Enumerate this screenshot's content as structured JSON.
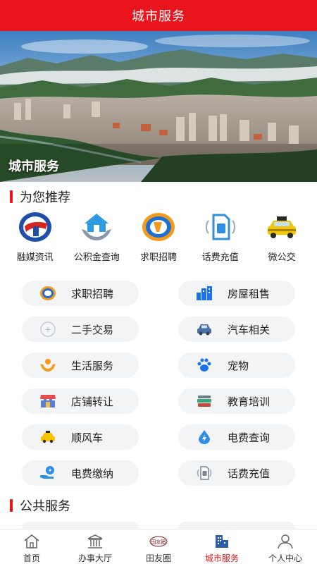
{
  "header": {
    "title": "城市服务"
  },
  "banner": {
    "caption": "城市服务"
  },
  "recommend": {
    "title": "为您推荐",
    "items": [
      {
        "label": "融媒资讯",
        "icon": "media-logo-icon"
      },
      {
        "label": "公积金查询",
        "icon": "house-hands-icon"
      },
      {
        "label": "求职招聘",
        "icon": "job-logo-icon"
      },
      {
        "label": "话费充值",
        "icon": "sim-card-icon"
      },
      {
        "label": "微公交",
        "icon": "taxi-icon"
      }
    ]
  },
  "services": [
    {
      "label": "求职招聘",
      "icon": "job-logo-icon"
    },
    {
      "label": "房屋租售",
      "icon": "buildings-icon"
    },
    {
      "label": "二手交易",
      "icon": "secondhand-icon"
    },
    {
      "label": "汽车相关",
      "icon": "car-icon"
    },
    {
      "label": "生活服务",
      "icon": "hands-service-icon"
    },
    {
      "label": "宠物",
      "icon": "paw-icon"
    },
    {
      "label": "店铺转让",
      "icon": "shop-icon"
    },
    {
      "label": "教育培训",
      "icon": "books-icon"
    },
    {
      "label": "顺风车",
      "icon": "taxi-icon"
    },
    {
      "label": "电费查询",
      "icon": "bolt-drop-icon"
    },
    {
      "label": "电费缴纳",
      "icon": "bolt-hand-icon"
    },
    {
      "label": "话费充值",
      "icon": "sim-card-icon"
    }
  ],
  "public": {
    "title": "公共服务"
  },
  "tabbar": {
    "items": [
      {
        "label": "首页",
        "icon": "home-icon"
      },
      {
        "label": "办事大厅",
        "icon": "hall-icon"
      },
      {
        "label": "田友圈",
        "icon": "circle-logo-icon",
        "logo_text": "田友圈"
      },
      {
        "label": "城市服务",
        "icon": "city-icon"
      },
      {
        "label": "个人中心",
        "icon": "person-icon"
      }
    ],
    "active_index": 3
  },
  "colors": {
    "brand_red": "#e8161c",
    "pill_bg": "#f3f4f6",
    "icon_blue": "#1a73e8"
  }
}
